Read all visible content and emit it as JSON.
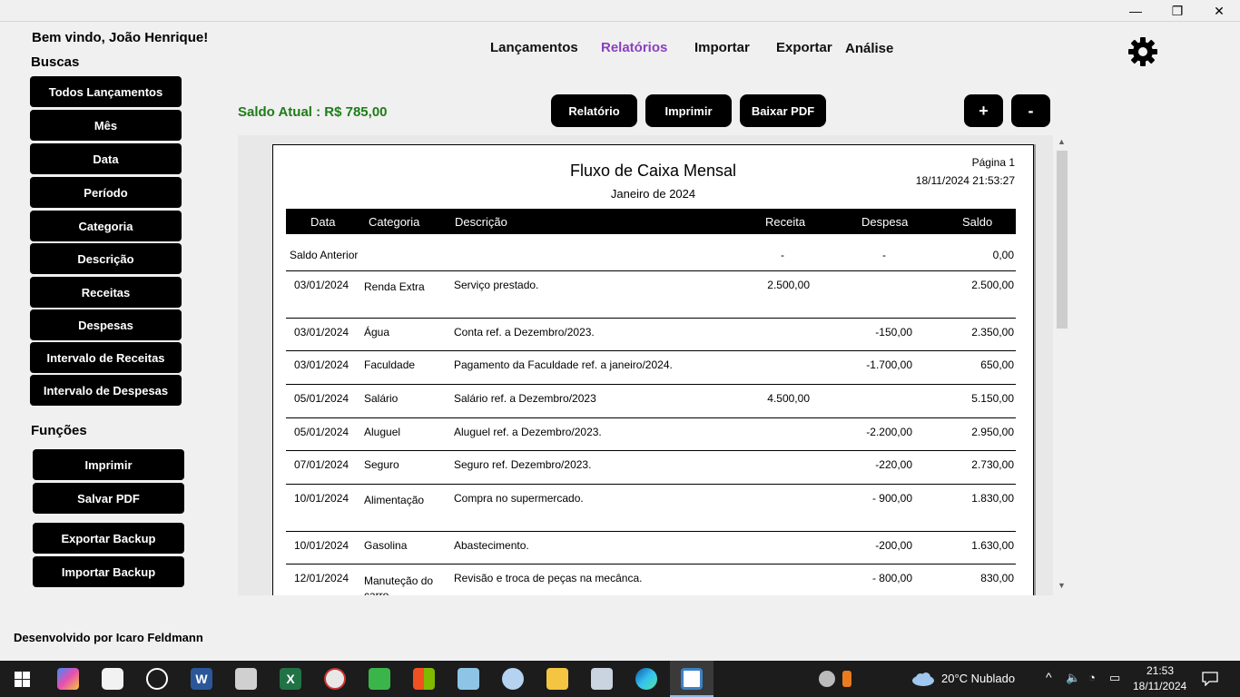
{
  "window": {
    "minimize": "—",
    "restore": "❐",
    "close": "✕"
  },
  "welcome": "Bem vindo, João Henrique!",
  "buscas": {
    "title": "Buscas",
    "items": [
      "Todos Lançamentos",
      "Mês",
      "Data",
      "Período",
      "Categoria",
      "Descrição",
      "Receitas",
      "Despesas",
      "Intervalo de Receitas",
      "Intervalo de Despesas"
    ]
  },
  "funcoes": {
    "title": "Funções",
    "items": [
      "Imprimir",
      "Salvar PDF",
      "Exportar Backup",
      "Importar Backup"
    ]
  },
  "footer": "Desenvolvido por Icaro Feldmann",
  "nav": [
    "Lançamentos",
    "Relatórios",
    "Importar",
    "Exportar",
    "Análise"
  ],
  "nav_active_color": "#8b3fbf",
  "saldo": "Saldo Atual : R$ 785,00",
  "saldo_color": "#1e7d18",
  "toolbar": {
    "relatorio": "Relatório",
    "imprimir": "Imprimir",
    "baixar_pdf": "Baixar PDF",
    "zoom_in": "+",
    "zoom_out": "-"
  },
  "report": {
    "title": "Fluxo de Caixa Mensal",
    "subtitle": "Janeiro de 2024",
    "page": "Página 1",
    "datetime": "18/11/2024 21:53:27",
    "columns": [
      "Data",
      "Categoria",
      "Descrição",
      "Receita",
      "Despesa",
      "Saldo"
    ],
    "saldo_anterior": {
      "label": "Saldo Anterior",
      "receita": "-",
      "despesa": "-",
      "saldo": "0,00"
    },
    "rows": [
      {
        "data": "03/01/2024",
        "categoria": "Renda Extra",
        "descricao": "Serviço prestado.",
        "receita": "2.500,00",
        "despesa": "",
        "saldo": "2.500,00"
      },
      {
        "data": "03/01/2024",
        "categoria": "Água",
        "descricao": "Conta ref. a Dezembro/2023.",
        "receita": "",
        "despesa": "-150,00",
        "saldo": "2.350,00"
      },
      {
        "data": "03/01/2024",
        "categoria": "Faculdade",
        "descricao": "Pagamento da Faculdade ref.  a janeiro/2024.",
        "receita": "",
        "despesa": "-1.700,00",
        "saldo": "650,00"
      },
      {
        "data": "05/01/2024",
        "categoria": "Salário",
        "descricao": "Salário ref. a Dezembro/2023",
        "receita": "4.500,00",
        "despesa": "",
        "saldo": "5.150,00"
      },
      {
        "data": "05/01/2024",
        "categoria": "Aluguel",
        "descricao": "Aluguel ref. a Dezembro/2023.",
        "receita": "",
        "despesa": "-2.200,00",
        "saldo": "2.950,00"
      },
      {
        "data": "07/01/2024",
        "categoria": "Seguro",
        "descricao": "Seguro ref. Dezembro/2023.",
        "receita": "",
        "despesa": "-220,00",
        "saldo": "2.730,00"
      },
      {
        "data": "10/01/2024",
        "categoria": "Alimentação",
        "descricao": "Compra no supermercado.",
        "receita": "",
        "despesa": "- 900,00",
        "saldo": "1.830,00"
      },
      {
        "data": "10/01/2024",
        "categoria": "Gasolina",
        "descricao": "Abastecimento.",
        "receita": "",
        "despesa": "-200,00",
        "saldo": "1.630,00"
      },
      {
        "data": "12/01/2024",
        "categoria": "Manuteção do carro",
        "descricao": "Revisão e troca de peças na mecânca.",
        "receita": "",
        "despesa": "- 800,00",
        "saldo": "830,00"
      }
    ]
  },
  "taskbar": {
    "weather": "20°C  Nublado",
    "time": "21:53",
    "date": "18/11/2024",
    "icons": [
      "windows-start-icon",
      "copilot-icon",
      "camera-icon",
      "photos-icon",
      "word-icon",
      "calculator-icon",
      "excel-icon",
      "compass-icon",
      "green-app-icon",
      "store-icon",
      "notes-icon",
      "paint-icon",
      "folder-icon",
      "monitor-icon",
      "edge-icon",
      "app-window-icon"
    ]
  }
}
